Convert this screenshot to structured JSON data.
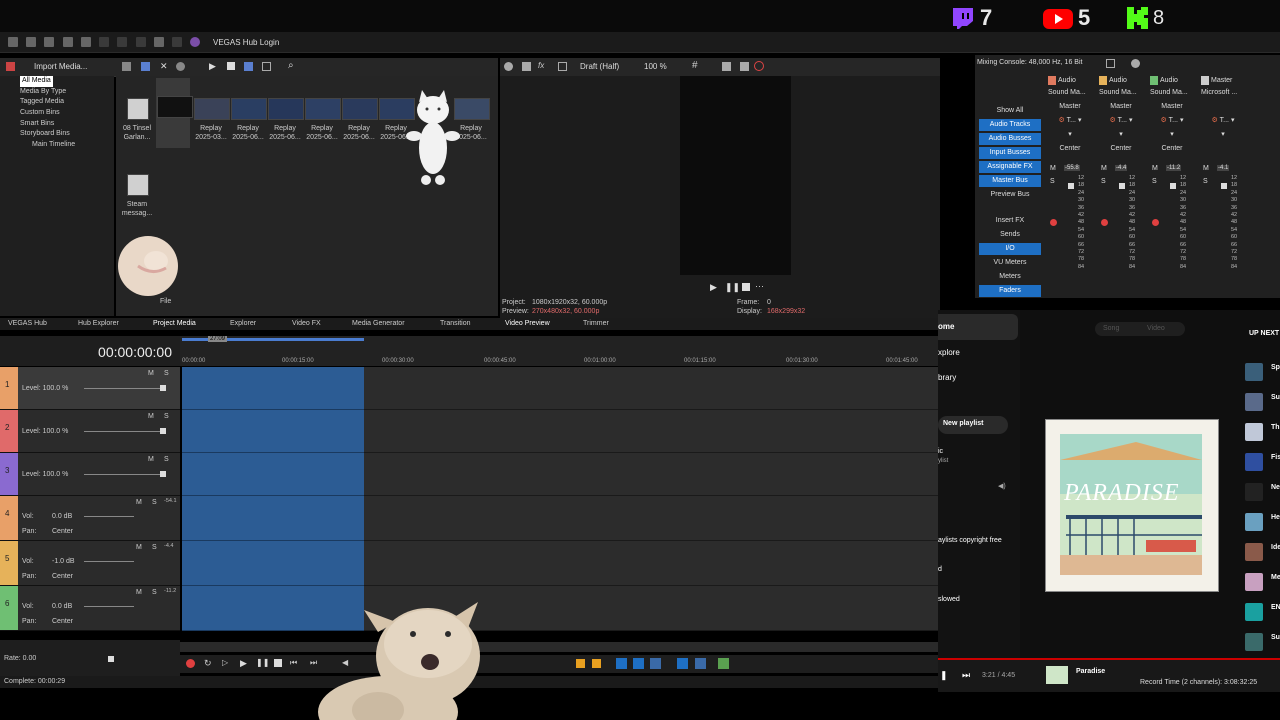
{
  "overlay": {
    "stats": [
      {
        "icon": "twitch-icon",
        "value": "7",
        "color": "#9146ff"
      },
      {
        "icon": "youtube-icon",
        "value": "5",
        "color": "#ff0000"
      },
      {
        "icon": "kick-icon",
        "value": "8",
        "color": "#53fc18"
      }
    ]
  },
  "toolbar": {
    "hub_login": "VEGAS Hub Login"
  },
  "project_media": {
    "import_label": "Import Media...",
    "tree": [
      "All Media",
      "Media By Type",
      "Tagged Media",
      "Custom Bins",
      "Smart Bins",
      "Storyboard Bins",
      "Main Timeline"
    ],
    "thumbs": [
      {
        "l1": "08 Tinsel",
        "l2": "Garlan..."
      },
      {
        "l1": "",
        "l2": ""
      },
      {
        "l1": "Replay",
        "l2": "2025-03..."
      },
      {
        "l1": "Replay",
        "l2": "2025-06..."
      },
      {
        "l1": "Replay",
        "l2": "2025-06..."
      },
      {
        "l1": "Replay",
        "l2": "2025-06..."
      },
      {
        "l1": "Replay",
        "l2": "2025-06..."
      },
      {
        "l1": "Replay",
        "l2": "2025-06..."
      },
      {
        "l1": "Replay",
        "l2": "2025-06..."
      },
      {
        "l1": "Steam",
        "l2": "messag..."
      }
    ],
    "file_label": "File"
  },
  "preview": {
    "quality": "Draft (Half)",
    "zoom": "100 %",
    "project_label": "Project:",
    "project_value": "1080x1920x32, 60.000p",
    "preview_label": "Preview:",
    "preview_value": "270x480x32, 60.000p",
    "frame_label": "Frame:",
    "frame_value": "0",
    "display_label": "Display:",
    "display_value": "168x299x32"
  },
  "mixer": {
    "title": "Mixing Console: 48,000 Hz, 16 Bit",
    "buttons": [
      {
        "label": "Show All",
        "active": false
      },
      {
        "label": "Audio Tracks",
        "active": true
      },
      {
        "label": "Audio Busses",
        "active": true
      },
      {
        "label": "Input Busses",
        "active": true
      },
      {
        "label": "Assignable FX",
        "active": true
      },
      {
        "label": "Master Bus",
        "active": true
      },
      {
        "label": "Preview Bus",
        "active": false
      },
      {
        "label": "Insert FX",
        "active": false
      },
      {
        "label": "Sends",
        "active": false
      },
      {
        "label": "I/O",
        "active": true
      },
      {
        "label": "VU Meters",
        "active": false
      },
      {
        "label": "Meters",
        "active": false
      },
      {
        "label": "Faders",
        "active": true
      }
    ],
    "strips": [
      {
        "name": "Audio",
        "color": "#e07a5f",
        "route": "Sound Ma...",
        "out": "Master",
        "fx": "T...",
        "pan": "Center",
        "peak": "-55.8"
      },
      {
        "name": "Audio",
        "color": "#e6b25a",
        "route": "Sound Ma...",
        "out": "Master",
        "fx": "T...",
        "pan": "Center",
        "peak": "-4.4"
      },
      {
        "name": "Audio",
        "color": "#6fbf73",
        "route": "Sound Ma...",
        "out": "Master",
        "fx": "T...",
        "pan": "Center",
        "peak": "-11.2"
      },
      {
        "name": "Master",
        "color": "#cccccc",
        "route": "Microsoft ...",
        "out": "",
        "fx": "T...",
        "pan": "",
        "peak": "-4.1"
      }
    ],
    "scale": [
      "12",
      "18",
      "24",
      "30",
      "36",
      "42",
      "48",
      "54",
      "60",
      "66",
      "72",
      "78",
      "84"
    ]
  },
  "tabs": [
    "VEGAS Hub",
    "Hub Explorer",
    "Project Media",
    "Explorer",
    "Video FX",
    "Media Generator",
    "Transition",
    "Video Preview",
    "Trimmer"
  ],
  "timeline": {
    "timecode": "00:00:00:00",
    "marker": "27:09",
    "ticks": [
      "00:00:00",
      "00:00:15:00",
      "00:00:30:00",
      "00:00:45:00",
      "00:01:00:00",
      "00:01:15:00",
      "00:01:30:00",
      "00:01:45:00"
    ],
    "tracks": [
      {
        "n": "1",
        "kind": "video",
        "color": "#e8a068",
        "label": "Level: 100.0 %"
      },
      {
        "n": "2",
        "kind": "video",
        "color": "#e06a6a",
        "label": "Level: 100.0 %"
      },
      {
        "n": "3",
        "kind": "video",
        "color": "#8a6ad0",
        "label": "Level: 100.0 %"
      },
      {
        "n": "4",
        "kind": "audio",
        "color": "#e8a068",
        "vol": "0.0 dB",
        "pan": "Center",
        "peak": "-54.1"
      },
      {
        "n": "5",
        "kind": "audio",
        "color": "#e6b25a",
        "vol": "-1.0 dB",
        "pan": "Center",
        "peak": "-4.4"
      },
      {
        "n": "6",
        "kind": "audio",
        "color": "#6fbf73",
        "vol": "0.0 dB",
        "pan": "Center",
        "peak": "-11.2"
      }
    ],
    "rate": "Rate: 0.00",
    "complete": "Complete: 00:00:29",
    "record_time": "Record Time (2 channels): 3:08:32:25"
  },
  "ytmusic": {
    "nav": [
      "ome",
      "xplore",
      "brary"
    ],
    "new_playlist": "New playlist",
    "side_items": [
      "ic",
      "ylist",
      "aylists copyright free",
      "d",
      "slowed"
    ],
    "seg": [
      "Song",
      "Video"
    ],
    "up_next": "UP NEXT",
    "album_text": "PARADISE",
    "now_playing": "Paradise",
    "time": "3:21 / 4:45",
    "queue": [
      "Sp",
      "Su",
      "Th",
      "Fis",
      "Ne",
      "He",
      "Ide",
      "Me",
      "EN",
      "Su"
    ]
  }
}
